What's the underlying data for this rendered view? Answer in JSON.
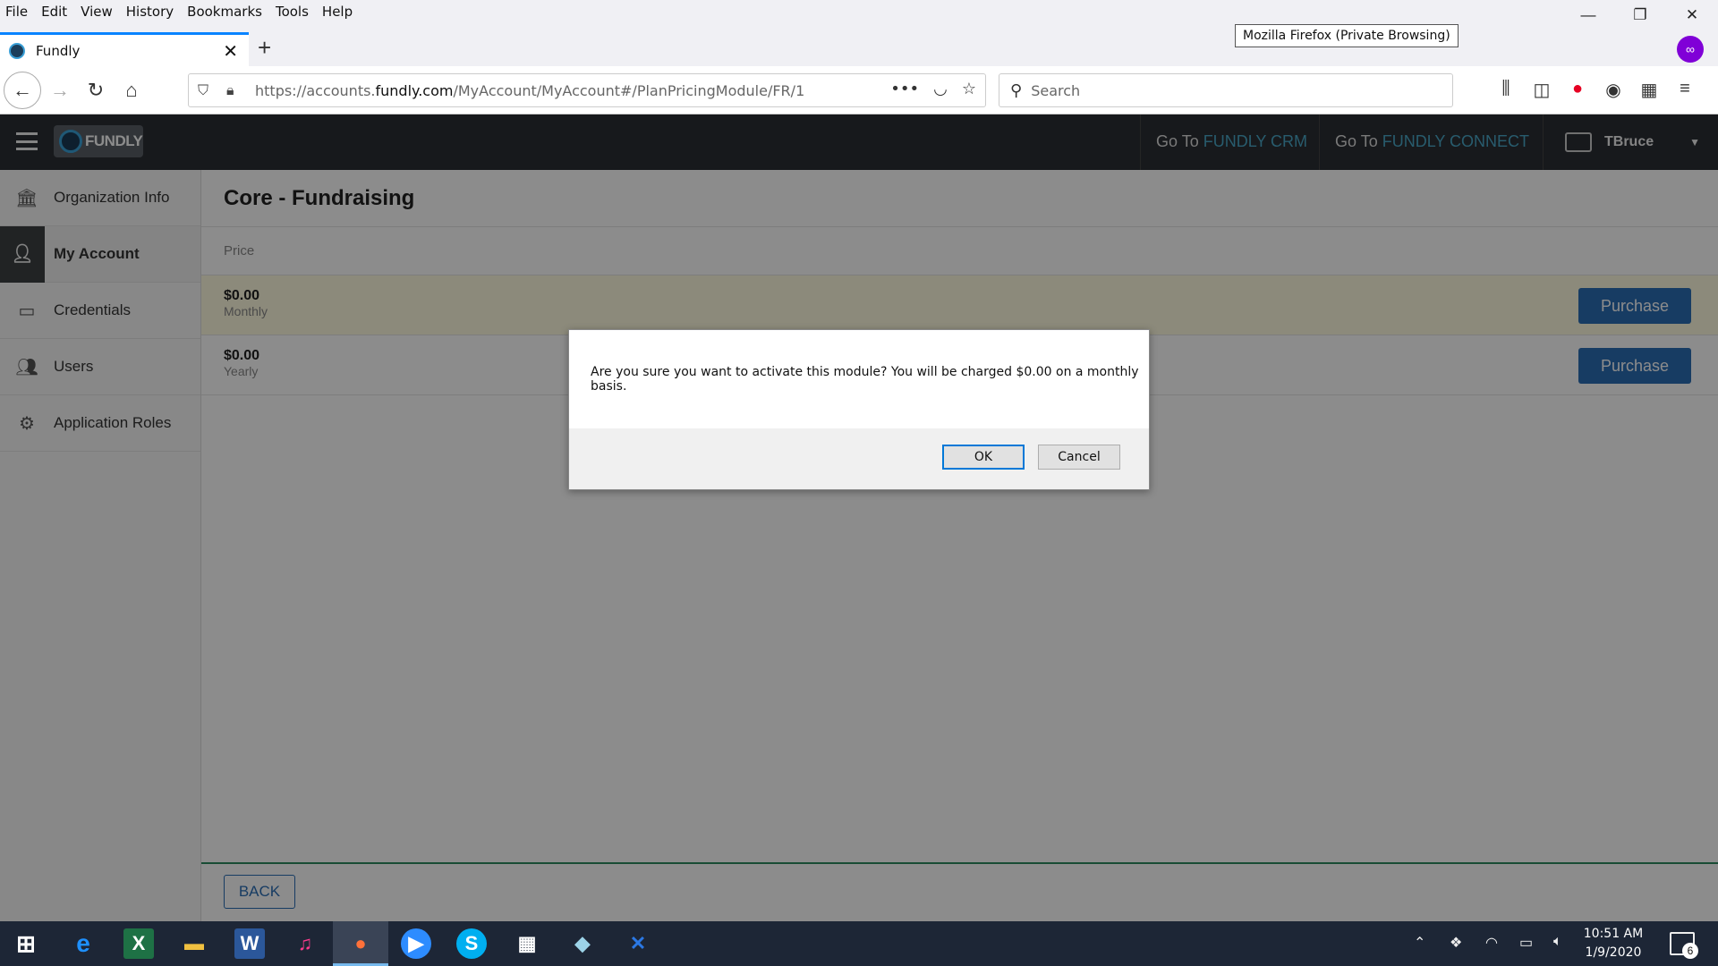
{
  "browser": {
    "menu": [
      "File",
      "Edit",
      "View",
      "History",
      "Bookmarks",
      "Tools",
      "Help"
    ],
    "tooltip": "Mozilla Firefox (Private Browsing)",
    "tab_title": "Fundly",
    "url_prefix": "https://accounts.",
    "url_domain": "fundly.com",
    "url_path": "/MyAccount/MyAccount#/PlanPricingModule/FR/1",
    "search_placeholder": "Search",
    "accent": "#0a84ff"
  },
  "app": {
    "logo_text": "FUNDLY",
    "top_links": [
      {
        "prefix": "Go To ",
        "accent": "FUNDLY CRM"
      },
      {
        "prefix": "Go To ",
        "accent": "FUNDLY CONNECT"
      }
    ],
    "user_name": "TBruce",
    "sidebar": [
      {
        "label": "Organization Info",
        "icon": "bank-icon"
      },
      {
        "label": "My Account",
        "icon": "user-icon",
        "active": true
      },
      {
        "label": "Credentials",
        "icon": "credit-card-icon"
      },
      {
        "label": "Users",
        "icon": "users-icon"
      },
      {
        "label": "Application Roles",
        "icon": "gear-icon"
      }
    ],
    "content_title": "Core - Fundraising",
    "price_header": "Price",
    "plans": [
      {
        "amount": "$0.00",
        "period": "Monthly",
        "button": "Purchase"
      },
      {
        "amount": "$0.00",
        "period": "Yearly",
        "button": "Purchase"
      }
    ],
    "back_label": "BACK",
    "brand_color": "#2a6db5"
  },
  "dialog": {
    "message": "Are you sure you want to activate this module? You will be charged $0.00 on a monthly basis.",
    "ok_label": "OK",
    "cancel_label": "Cancel"
  },
  "taskbar": {
    "time": "10:51 AM",
    "date": "1/9/2020",
    "notification_count": "6"
  }
}
